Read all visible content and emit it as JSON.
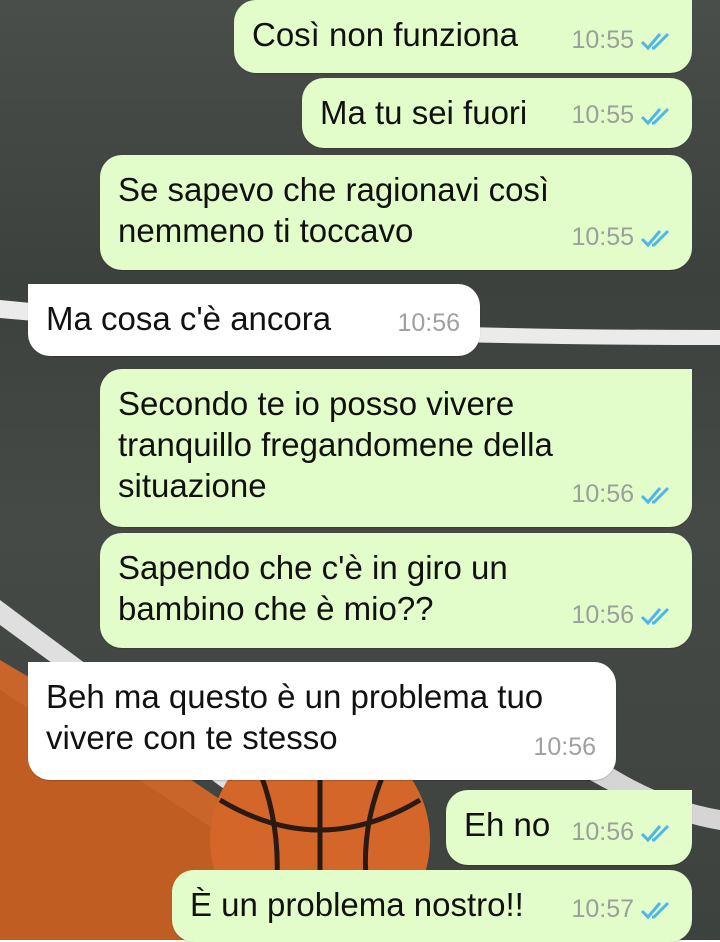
{
  "colors": {
    "outgoing": "#e2fdc9",
    "incoming": "#ffffff",
    "read_ticks": "#4fb6ec"
  },
  "messages": [
    {
      "dir": "out",
      "text": "Così non funziona",
      "time": "10:55",
      "status": "read-ticks-icon"
    },
    {
      "dir": "out",
      "text": "Ma tu sei fuori",
      "time": "10:55",
      "status": "read-ticks-icon"
    },
    {
      "dir": "out",
      "text": "Se sapevo che ragionavi così\nnemmeno ti toccavo",
      "time": "10:55",
      "status": "read-ticks-icon"
    },
    {
      "dir": "in",
      "text": "Ma cosa c'è ancora",
      "time": "10:56"
    },
    {
      "dir": "out",
      "text": "Secondo te io posso vivere\ntranquillo fregandomene della\nsituazione",
      "time": "10:56",
      "status": "read-ticks-icon"
    },
    {
      "dir": "out",
      "text": "Sapendo che c'è in giro un\nbambino che è mio??",
      "time": "10:56",
      "status": "read-ticks-icon"
    },
    {
      "dir": "in",
      "text": "Beh ma questo è un problema tuo\nvivere con te stesso",
      "time": "10:56"
    },
    {
      "dir": "out",
      "text": "Eh no",
      "time": "10:56",
      "status": "read-ticks-icon"
    },
    {
      "dir": "out",
      "text": "È un problema nostro!!",
      "time": "10:57",
      "status": "read-ticks-icon"
    }
  ]
}
